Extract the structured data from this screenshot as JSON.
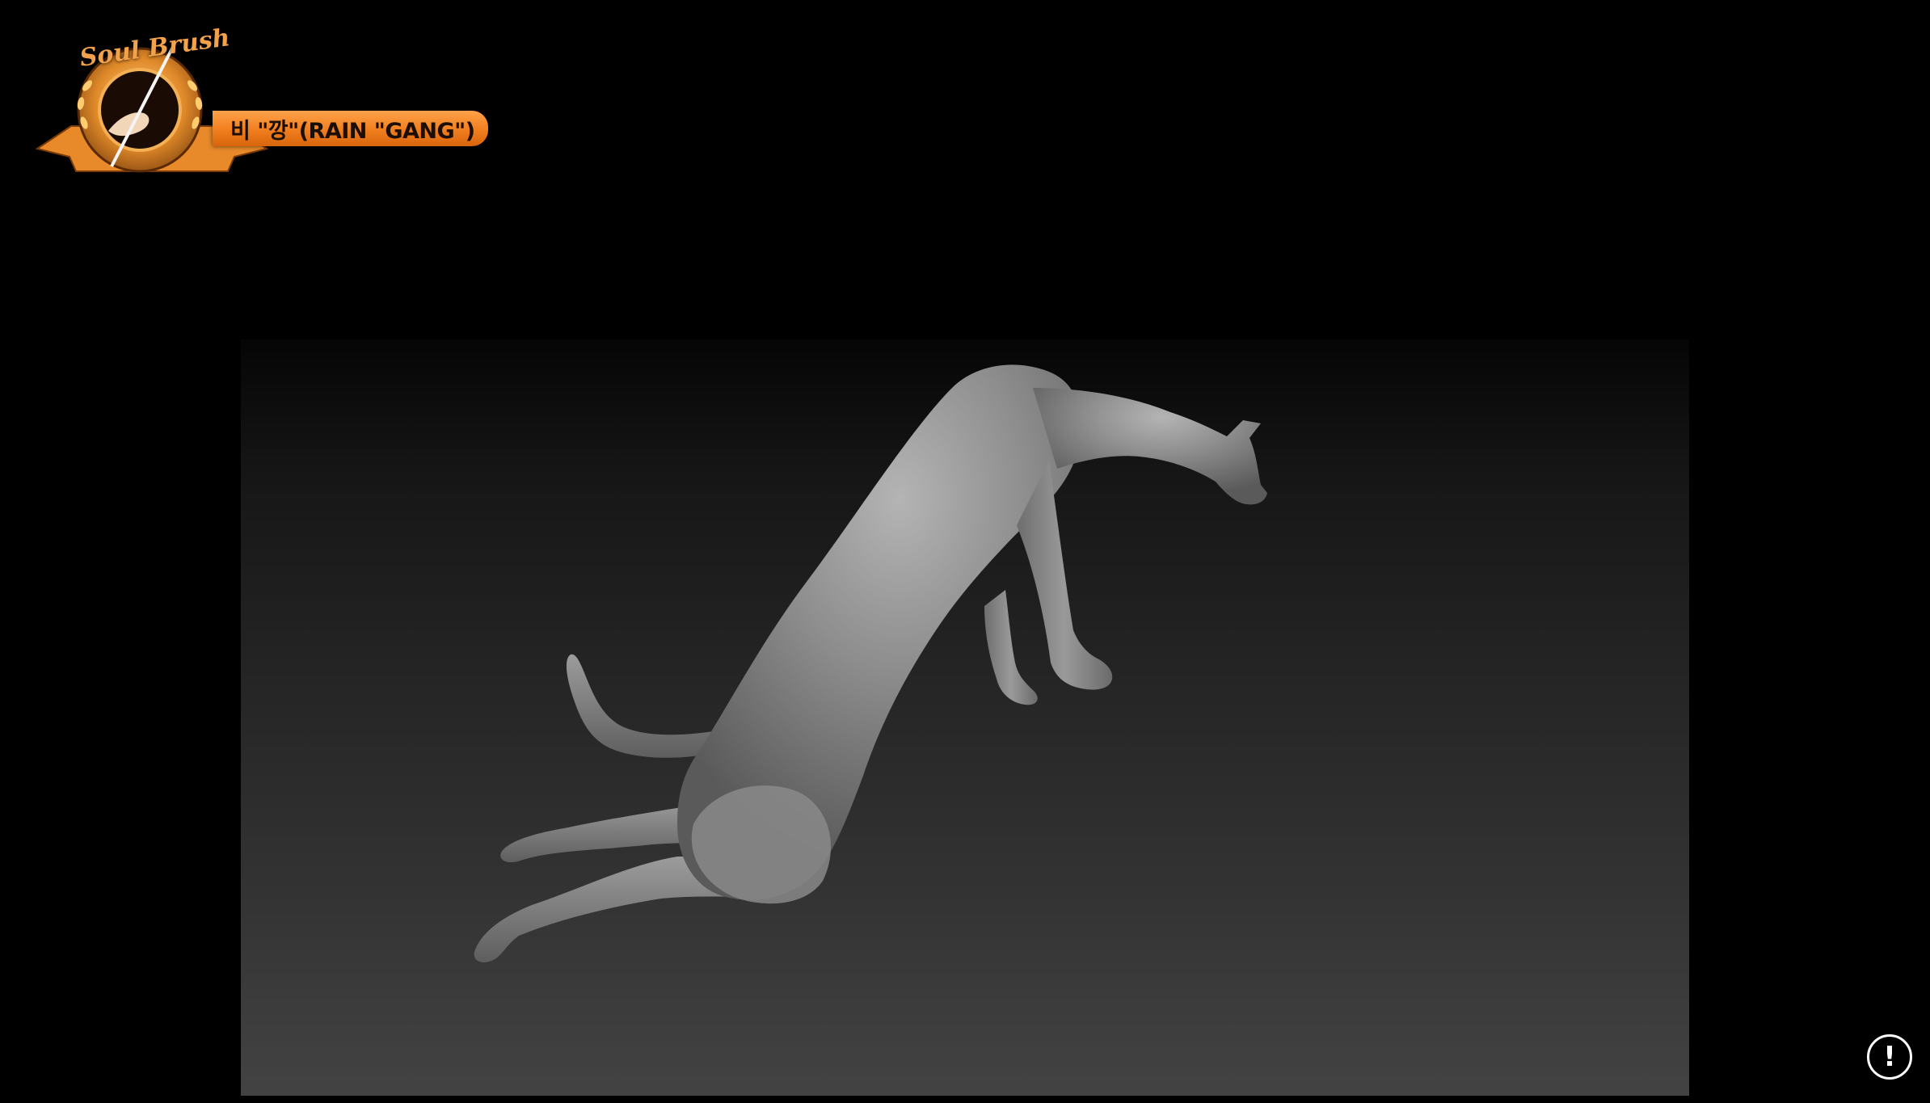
{
  "logo": {
    "brand_script": "Soul Brush",
    "banner_text": "비 \"깡\"(RAIN \"GANG\")",
    "accent_color": "#f07e1e"
  },
  "viewport": {
    "subject": "sculpt-model-cat"
  },
  "info_button": {
    "label": "!",
    "icon": "exclamation-circle-icon"
  }
}
